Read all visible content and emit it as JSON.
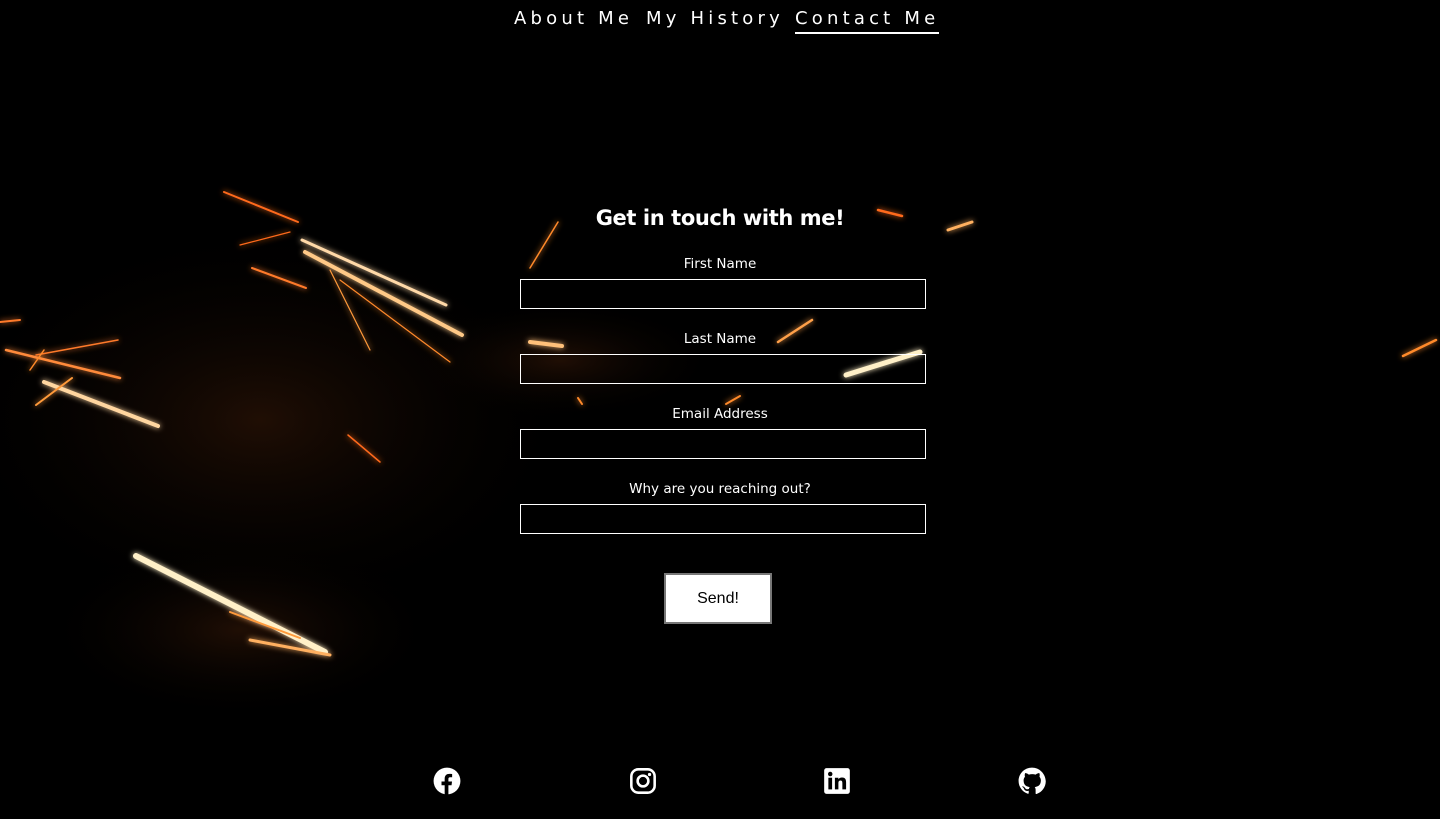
{
  "nav": {
    "items": [
      {
        "label": "About Me",
        "active": false
      },
      {
        "label": "My History",
        "active": false
      },
      {
        "label": "Contact Me",
        "active": true
      }
    ]
  },
  "contact": {
    "title": "Get in touch with me!",
    "fields": {
      "first_name": {
        "label": "First Name",
        "value": ""
      },
      "last_name": {
        "label": "Last Name",
        "value": ""
      },
      "email": {
        "label": "Email Address",
        "value": ""
      },
      "reason": {
        "label": "Why are you reaching out?",
        "value": ""
      }
    },
    "submit_label": "Send!"
  },
  "social": [
    {
      "icon": "facebook-icon"
    },
    {
      "icon": "instagram-icon"
    },
    {
      "icon": "linkedin-icon"
    },
    {
      "icon": "github-icon"
    }
  ],
  "colors": {
    "background": "#000000",
    "text": "#ffffff",
    "spark_core": "#fff1d0",
    "spark_glow": "#ff7a1a"
  }
}
